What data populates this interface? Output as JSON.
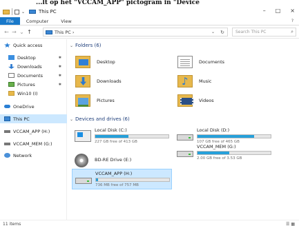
{
  "caption": "...lt op het \"VCCAM_APP\" pictogram in \"Device",
  "window": {
    "title": "This PC",
    "controls": [
      "–",
      "□",
      "×"
    ]
  },
  "ribbon": {
    "tabs": [
      "File",
      "Computer",
      "View"
    ],
    "help": "?"
  },
  "address": {
    "back": "←",
    "forward": "→",
    "recent": "⌄",
    "up": "↑",
    "path": "This PC ›",
    "dropdown": "⌄",
    "refresh": "↻",
    "search_placeholder": "Search This PC",
    "search_icon": "⌕"
  },
  "nav": {
    "items": [
      {
        "label": "Quick access",
        "icon": "star-icon",
        "pinned": false,
        "selected": false
      },
      {
        "label": "Desktop",
        "icon": "desktop-icon",
        "pinned": true,
        "selected": false
      },
      {
        "label": "Downloads",
        "icon": "downloads-icon",
        "pinned": true,
        "selected": false
      },
      {
        "label": "Documents",
        "icon": "documents-icon",
        "pinned": true,
        "selected": false
      },
      {
        "label": "Pictures",
        "icon": "pictures-icon",
        "pinned": true,
        "selected": false
      },
      {
        "label": "Win10 (I)",
        "icon": "folder-icon",
        "pinned": false,
        "selected": false
      },
      {
        "label": "OneDrive",
        "icon": "onedrive-icon",
        "pinned": false,
        "selected": false
      },
      {
        "label": "This PC",
        "icon": "this-pc-icon",
        "pinned": false,
        "selected": true
      },
      {
        "label": "VCCAM_APP (H:)",
        "icon": "drive-icon",
        "pinned": false,
        "selected": false
      },
      {
        "label": "VCCAM_MEM (G:)",
        "icon": "drive-icon",
        "pinned": false,
        "selected": false
      },
      {
        "label": "Network",
        "icon": "network-icon",
        "pinned": false,
        "selected": false
      }
    ],
    "pin_glyph": "✱"
  },
  "content": {
    "folders_header": "Folders (6)",
    "folders": [
      {
        "label": "Desktop",
        "icon": "desktop-folder-icon"
      },
      {
        "label": "Documents",
        "icon": "documents-folder-icon"
      },
      {
        "label": "Downloads",
        "icon": "downloads-folder-icon"
      },
      {
        "label": "Music",
        "icon": "music-folder-icon"
      },
      {
        "label": "Pictures",
        "icon": "pictures-folder-icon"
      },
      {
        "label": "Videos",
        "icon": "videos-folder-icon"
      }
    ],
    "devices_header": "Devices and drives (6)",
    "drives": [
      {
        "name": "Local Disk (C:)",
        "free": "227 GB free of 413 GB",
        "used_fraction": 0.45,
        "icon": "windows-drive-icon"
      },
      {
        "name": "Local Disk (D:)",
        "free": "107 GB free of 465 GB",
        "used_fraction": 0.77,
        "icon": "hard-drive-icon"
      },
      {
        "name": "BD-RE Drive (E:)",
        "free": "",
        "used_fraction": null,
        "icon": "bd-drive-icon"
      },
      {
        "name": "VCCAM_MEM (G:)",
        "free": "2.00 GB free of 3.53 GB",
        "used_fraction": 0.43,
        "icon": "usb-drive-icon"
      },
      {
        "name": "VCCAM_APP (H:)",
        "free": "736 MB free of 757 MB",
        "used_fraction": 0.03,
        "icon": "usb-drive-icon"
      }
    ]
  },
  "status": {
    "items": "11 items",
    "views": "☰ ▦"
  },
  "colors": {
    "accent": "#1979ca",
    "selection": "#cce8ff",
    "progress": "#26a0da",
    "header": "#1e3e7a"
  }
}
